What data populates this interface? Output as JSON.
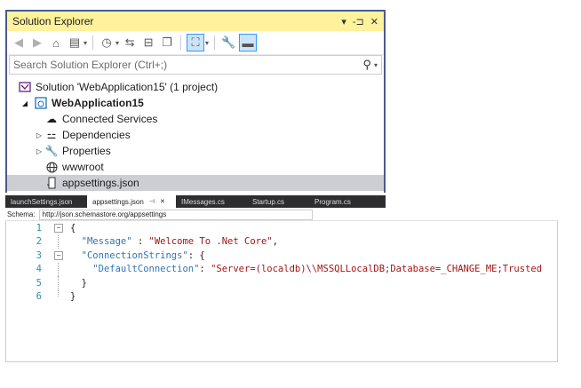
{
  "solution_explorer": {
    "title": "Solution Explorer",
    "pin_label": "▾",
    "autohide_label": "-⊐",
    "close_label": "✕",
    "search_placeholder": "Search Solution Explorer (Ctrl+;)",
    "tree": {
      "solution": "Solution 'WebApplication15' (1 project)",
      "project": "WebApplication15",
      "items": [
        "Connected Services",
        "Dependencies",
        "Properties",
        "wwwroot",
        "appsettings.json"
      ]
    }
  },
  "editor": {
    "tabs": [
      {
        "label": "launchSettings.json",
        "active": false
      },
      {
        "label": "appsettings.json",
        "active": true
      },
      {
        "label": "IMessages.cs",
        "active": false
      },
      {
        "label": "Startup.cs",
        "active": false
      },
      {
        "label": "Program.cs",
        "active": false
      }
    ],
    "schema_label": "Schema:",
    "schema_value": "http://json.schemastore.org/appsettings",
    "lines": [
      {
        "num": "1",
        "text": "{"
      },
      {
        "num": "2",
        "key": "\"Message\"",
        "sep": " : ",
        "value": "\"Welcome To .Net Core\"",
        "tail": ","
      },
      {
        "num": "3",
        "key": "\"ConnectionStrings\"",
        "sep": ": ",
        "tail": "{"
      },
      {
        "num": "4",
        "key": "\"DefaultConnection\"",
        "sep": ": ",
        "value": "\"Server=(localdb)\\\\MSSQLLocalDB;Database=_CHANGE_ME;Trusted"
      },
      {
        "num": "5",
        "text": "}"
      },
      {
        "num": "6",
        "text": "}"
      }
    ]
  }
}
